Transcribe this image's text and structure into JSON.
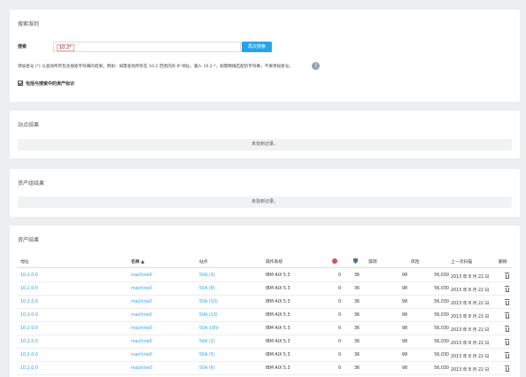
{
  "search": {
    "section_title": "搜索准则",
    "label": "搜索",
    "value": "10.2*",
    "button_label": "再次搜索",
    "hint": "添加星号 (*) 以查找所有包含搜索字符串的结果。例如：如需查找所有在 10.2 范围内的 IP 地址，输入 10.2.*。如需精确匹配的字符串，不要添加星号。",
    "help_glyph": "?",
    "checkbox_label": "包括与搜索中的资产标识"
  },
  "sites": {
    "title": "站点结果",
    "empty": "未找到记录。"
  },
  "asset_groups": {
    "title": "资产组结果",
    "empty": "未找到记录。"
  },
  "assets": {
    "title": "资产结果",
    "columns": {
      "address": "地址",
      "name": "名称 ▲",
      "site": "站点",
      "os": "操作系统",
      "malware": "",
      "exploits": "",
      "vulns": "漏洞",
      "risk": "风险",
      "last_scan": "上一次扫描",
      "delete": "删除"
    },
    "rows": [
      {
        "address": "10.2.0.0",
        "name": "machine0",
        "site": "50A (3)",
        "os": "IBM AIX 5.3",
        "malware": "0",
        "exploits": "36",
        "vulns": "98",
        "risk": "56,030",
        "last_scan": "2013 年 8 月 22 日"
      },
      {
        "address": "10.2.0.0",
        "name": "machine0",
        "site": "50A (8)",
        "os": "IBM AIX 5.3",
        "malware": "0",
        "exploits": "36",
        "vulns": "98",
        "risk": "56,030",
        "last_scan": "2013 年 8 月 22 日"
      },
      {
        "address": "10.2.0.0",
        "name": "machine0",
        "site": "50A (10)",
        "os": "IBM AIX 5.3",
        "malware": "0",
        "exploits": "36",
        "vulns": "98",
        "risk": "56,030",
        "last_scan": "2013 年 8 月 22 日"
      },
      {
        "address": "10.2.0.0",
        "name": "machine0",
        "site": "50A (13)",
        "os": "IBM AIX 5.3",
        "malware": "0",
        "exploits": "36",
        "vulns": "98",
        "risk": "56,030",
        "last_scan": "2013 年 8 月 22 日"
      },
      {
        "address": "10.2.0.0",
        "name": "machine0",
        "site": "50A 10IV",
        "os": "IBM AIX 5.3",
        "malware": "0",
        "exploits": "36",
        "vulns": "98",
        "risk": "56,030",
        "last_scan": "2013 年 8 月 22 日"
      },
      {
        "address": "10.2.0.0",
        "name": "machine0",
        "site": "50A (2)",
        "os": "IBM AIX 5.3",
        "malware": "0",
        "exploits": "36",
        "vulns": "98",
        "risk": "56,030",
        "last_scan": "2013 年 8 月 22 日"
      },
      {
        "address": "10.2.0.0",
        "name": "machine0",
        "site": "50A (5)",
        "os": "IBM AIX 5.3",
        "malware": "0",
        "exploits": "36",
        "vulns": "98",
        "risk": "56,030",
        "last_scan": "2013 年 8 月 22 日"
      },
      {
        "address": "10.2.0.0",
        "name": "machine0",
        "site": "50A (6)",
        "os": "IBM AIX 5.3",
        "malware": "0",
        "exploits": "36",
        "vulns": "98",
        "risk": "56,030",
        "last_scan": "2013 年 8 月 22 日"
      }
    ]
  },
  "colors": {
    "accent": "#28a4e6",
    "background": "#eceeef",
    "panel": "#ffffff"
  }
}
